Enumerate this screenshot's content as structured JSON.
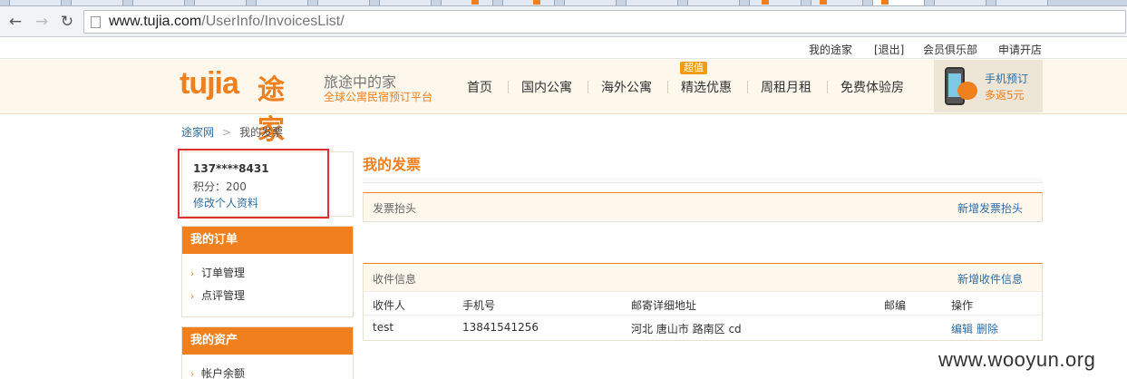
{
  "browser": {
    "url_host": "www.tujia.com",
    "url_path": "/UserInfo/InvoicesList/"
  },
  "topbar": {
    "links": [
      "我的途家",
      "[退出]",
      "会员俱乐部",
      "申请开店"
    ]
  },
  "header": {
    "logo_text": "tujia",
    "logo_cn": "途家",
    "slogan_main": "旅途中的家",
    "slogan_sub": "全球公寓民宿预订平台",
    "nav": [
      "首页",
      "国内公寓",
      "海外公寓",
      "精选优惠",
      "周租月租",
      "免费体验房"
    ],
    "hot_badge": "超值",
    "mobile_promo": {
      "line1": "手机预订",
      "line2": "多返5元"
    }
  },
  "breadcrumb": {
    "home": "途家网",
    "arrow": ">",
    "current": "我的发票"
  },
  "user": {
    "name": "137****8431",
    "points": "积分：200",
    "edit_link": "修改个人资料"
  },
  "sidebar": {
    "orders": {
      "title": "我的订单",
      "items": [
        "订单管理",
        "点评管理"
      ]
    },
    "assets": {
      "title": "我的资产",
      "items": [
        "帐户余额"
      ]
    }
  },
  "main": {
    "title": "我的发票",
    "invoice_header": {
      "label": "发票抬头",
      "action": "新增发票抬头"
    },
    "recipient": {
      "label": "收件信息",
      "action": "新增收件信息",
      "columns": [
        "收件人",
        "手机号",
        "邮寄详细地址",
        "邮编",
        "操作"
      ],
      "rows": [
        {
          "name": "test",
          "phone": "13841541256",
          "address": "河北 唐山市 路南区 cd",
          "zip": "",
          "edit": "编辑",
          "delete": "删除"
        }
      ]
    }
  },
  "watermark": "www.wooyun.org",
  "colors": {
    "brand_orange": "#f07f1e",
    "link_blue": "#2e6da4",
    "highlight_red": "#e03131"
  }
}
